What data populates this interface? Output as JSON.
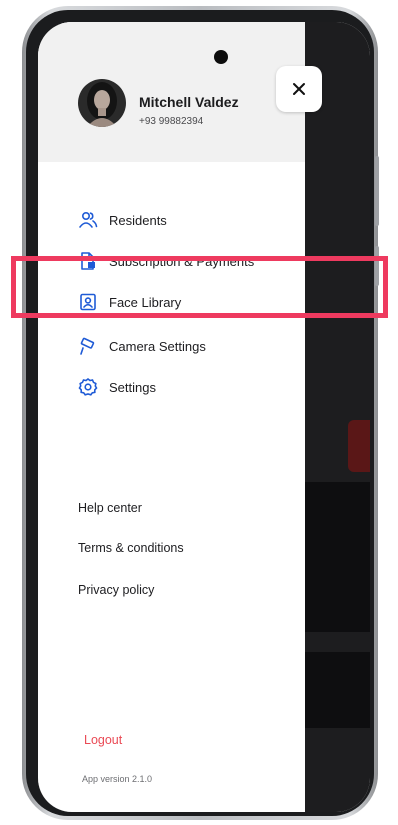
{
  "profile": {
    "name": "Mitchell Valdez",
    "phone": "+93 99882394"
  },
  "menu": {
    "items": [
      {
        "label": "Residents",
        "icon": "residents-icon"
      },
      {
        "label": "Subscription & Payments",
        "icon": "document-icon"
      },
      {
        "label": "Face Library",
        "icon": "face-id-icon"
      },
      {
        "label": "Camera Settings",
        "icon": "camera-icon"
      },
      {
        "label": "Settings",
        "icon": "gear-icon"
      }
    ]
  },
  "links": {
    "help": "Help center",
    "terms": "Terms & conditions",
    "privacy": "Privacy policy"
  },
  "logout_label": "Logout",
  "app_version": "App version 2.1.0",
  "colors": {
    "accent": "#1f5bd6",
    "highlight": "#ee3a5f",
    "logout": "#ea4a55"
  },
  "icons": {
    "close": "close-icon",
    "avatar": "avatar"
  }
}
